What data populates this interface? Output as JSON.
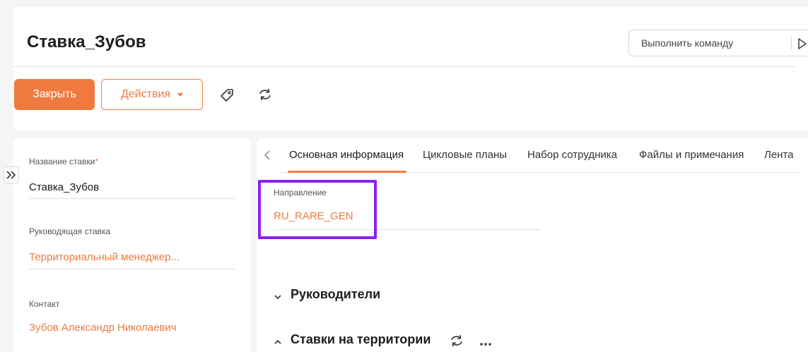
{
  "header": {
    "title": "Ставка_Зубов",
    "command": {
      "placeholder": "Выполнить команду"
    }
  },
  "toolbar": {
    "close_label": "Закрыть",
    "actions_label": "Действия"
  },
  "left_panel": {
    "fields": [
      {
        "label": "Название ставки",
        "required": "*",
        "value": "Ставка_Зубов"
      },
      {
        "label": "Руководящая ставка",
        "value": "Территориальный менеджер..."
      },
      {
        "label": "Контакт",
        "value": "Зубов Александр Николаевич"
      }
    ]
  },
  "tabs": [
    {
      "label": "Основная информация",
      "active": true
    },
    {
      "label": "Цикловые планы"
    },
    {
      "label": "Набор сотрудника"
    },
    {
      "label": "Файлы и примечания"
    },
    {
      "label": "Лента"
    }
  ],
  "main": {
    "direction": {
      "label": "Направление",
      "value": "RU_RARE_GEN"
    },
    "sections": [
      {
        "title": "Руководители",
        "state": "collapsed"
      },
      {
        "title": "Ставки на территории",
        "state": "expanded"
      }
    ]
  },
  "colors": {
    "accent": "#f07a3e",
    "highlight": "#8a20f5",
    "background": "#f4f5f7"
  }
}
